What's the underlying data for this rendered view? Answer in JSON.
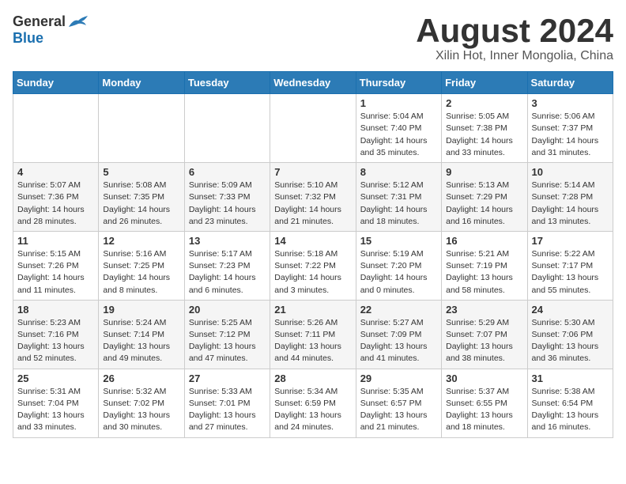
{
  "logo": {
    "general": "General",
    "blue": "Blue"
  },
  "title": "August 2024",
  "location": "Xilin Hot, Inner Mongolia, China",
  "days_of_week": [
    "Sunday",
    "Monday",
    "Tuesday",
    "Wednesday",
    "Thursday",
    "Friday",
    "Saturday"
  ],
  "weeks": [
    [
      {
        "day": "",
        "info": ""
      },
      {
        "day": "",
        "info": ""
      },
      {
        "day": "",
        "info": ""
      },
      {
        "day": "",
        "info": ""
      },
      {
        "day": "1",
        "info": "Sunrise: 5:04 AM\nSunset: 7:40 PM\nDaylight: 14 hours\nand 35 minutes."
      },
      {
        "day": "2",
        "info": "Sunrise: 5:05 AM\nSunset: 7:38 PM\nDaylight: 14 hours\nand 33 minutes."
      },
      {
        "day": "3",
        "info": "Sunrise: 5:06 AM\nSunset: 7:37 PM\nDaylight: 14 hours\nand 31 minutes."
      }
    ],
    [
      {
        "day": "4",
        "info": "Sunrise: 5:07 AM\nSunset: 7:36 PM\nDaylight: 14 hours\nand 28 minutes."
      },
      {
        "day": "5",
        "info": "Sunrise: 5:08 AM\nSunset: 7:35 PM\nDaylight: 14 hours\nand 26 minutes."
      },
      {
        "day": "6",
        "info": "Sunrise: 5:09 AM\nSunset: 7:33 PM\nDaylight: 14 hours\nand 23 minutes."
      },
      {
        "day": "7",
        "info": "Sunrise: 5:10 AM\nSunset: 7:32 PM\nDaylight: 14 hours\nand 21 minutes."
      },
      {
        "day": "8",
        "info": "Sunrise: 5:12 AM\nSunset: 7:31 PM\nDaylight: 14 hours\nand 18 minutes."
      },
      {
        "day": "9",
        "info": "Sunrise: 5:13 AM\nSunset: 7:29 PM\nDaylight: 14 hours\nand 16 minutes."
      },
      {
        "day": "10",
        "info": "Sunrise: 5:14 AM\nSunset: 7:28 PM\nDaylight: 14 hours\nand 13 minutes."
      }
    ],
    [
      {
        "day": "11",
        "info": "Sunrise: 5:15 AM\nSunset: 7:26 PM\nDaylight: 14 hours\nand 11 minutes."
      },
      {
        "day": "12",
        "info": "Sunrise: 5:16 AM\nSunset: 7:25 PM\nDaylight: 14 hours\nand 8 minutes."
      },
      {
        "day": "13",
        "info": "Sunrise: 5:17 AM\nSunset: 7:23 PM\nDaylight: 14 hours\nand 6 minutes."
      },
      {
        "day": "14",
        "info": "Sunrise: 5:18 AM\nSunset: 7:22 PM\nDaylight: 14 hours\nand 3 minutes."
      },
      {
        "day": "15",
        "info": "Sunrise: 5:19 AM\nSunset: 7:20 PM\nDaylight: 14 hours\nand 0 minutes."
      },
      {
        "day": "16",
        "info": "Sunrise: 5:21 AM\nSunset: 7:19 PM\nDaylight: 13 hours\nand 58 minutes."
      },
      {
        "day": "17",
        "info": "Sunrise: 5:22 AM\nSunset: 7:17 PM\nDaylight: 13 hours\nand 55 minutes."
      }
    ],
    [
      {
        "day": "18",
        "info": "Sunrise: 5:23 AM\nSunset: 7:16 PM\nDaylight: 13 hours\nand 52 minutes."
      },
      {
        "day": "19",
        "info": "Sunrise: 5:24 AM\nSunset: 7:14 PM\nDaylight: 13 hours\nand 49 minutes."
      },
      {
        "day": "20",
        "info": "Sunrise: 5:25 AM\nSunset: 7:12 PM\nDaylight: 13 hours\nand 47 minutes."
      },
      {
        "day": "21",
        "info": "Sunrise: 5:26 AM\nSunset: 7:11 PM\nDaylight: 13 hours\nand 44 minutes."
      },
      {
        "day": "22",
        "info": "Sunrise: 5:27 AM\nSunset: 7:09 PM\nDaylight: 13 hours\nand 41 minutes."
      },
      {
        "day": "23",
        "info": "Sunrise: 5:29 AM\nSunset: 7:07 PM\nDaylight: 13 hours\nand 38 minutes."
      },
      {
        "day": "24",
        "info": "Sunrise: 5:30 AM\nSunset: 7:06 PM\nDaylight: 13 hours\nand 36 minutes."
      }
    ],
    [
      {
        "day": "25",
        "info": "Sunrise: 5:31 AM\nSunset: 7:04 PM\nDaylight: 13 hours\nand 33 minutes."
      },
      {
        "day": "26",
        "info": "Sunrise: 5:32 AM\nSunset: 7:02 PM\nDaylight: 13 hours\nand 30 minutes."
      },
      {
        "day": "27",
        "info": "Sunrise: 5:33 AM\nSunset: 7:01 PM\nDaylight: 13 hours\nand 27 minutes."
      },
      {
        "day": "28",
        "info": "Sunrise: 5:34 AM\nSunset: 6:59 PM\nDaylight: 13 hours\nand 24 minutes."
      },
      {
        "day": "29",
        "info": "Sunrise: 5:35 AM\nSunset: 6:57 PM\nDaylight: 13 hours\nand 21 minutes."
      },
      {
        "day": "30",
        "info": "Sunrise: 5:37 AM\nSunset: 6:55 PM\nDaylight: 13 hours\nand 18 minutes."
      },
      {
        "day": "31",
        "info": "Sunrise: 5:38 AM\nSunset: 6:54 PM\nDaylight: 13 hours\nand 16 minutes."
      }
    ]
  ]
}
